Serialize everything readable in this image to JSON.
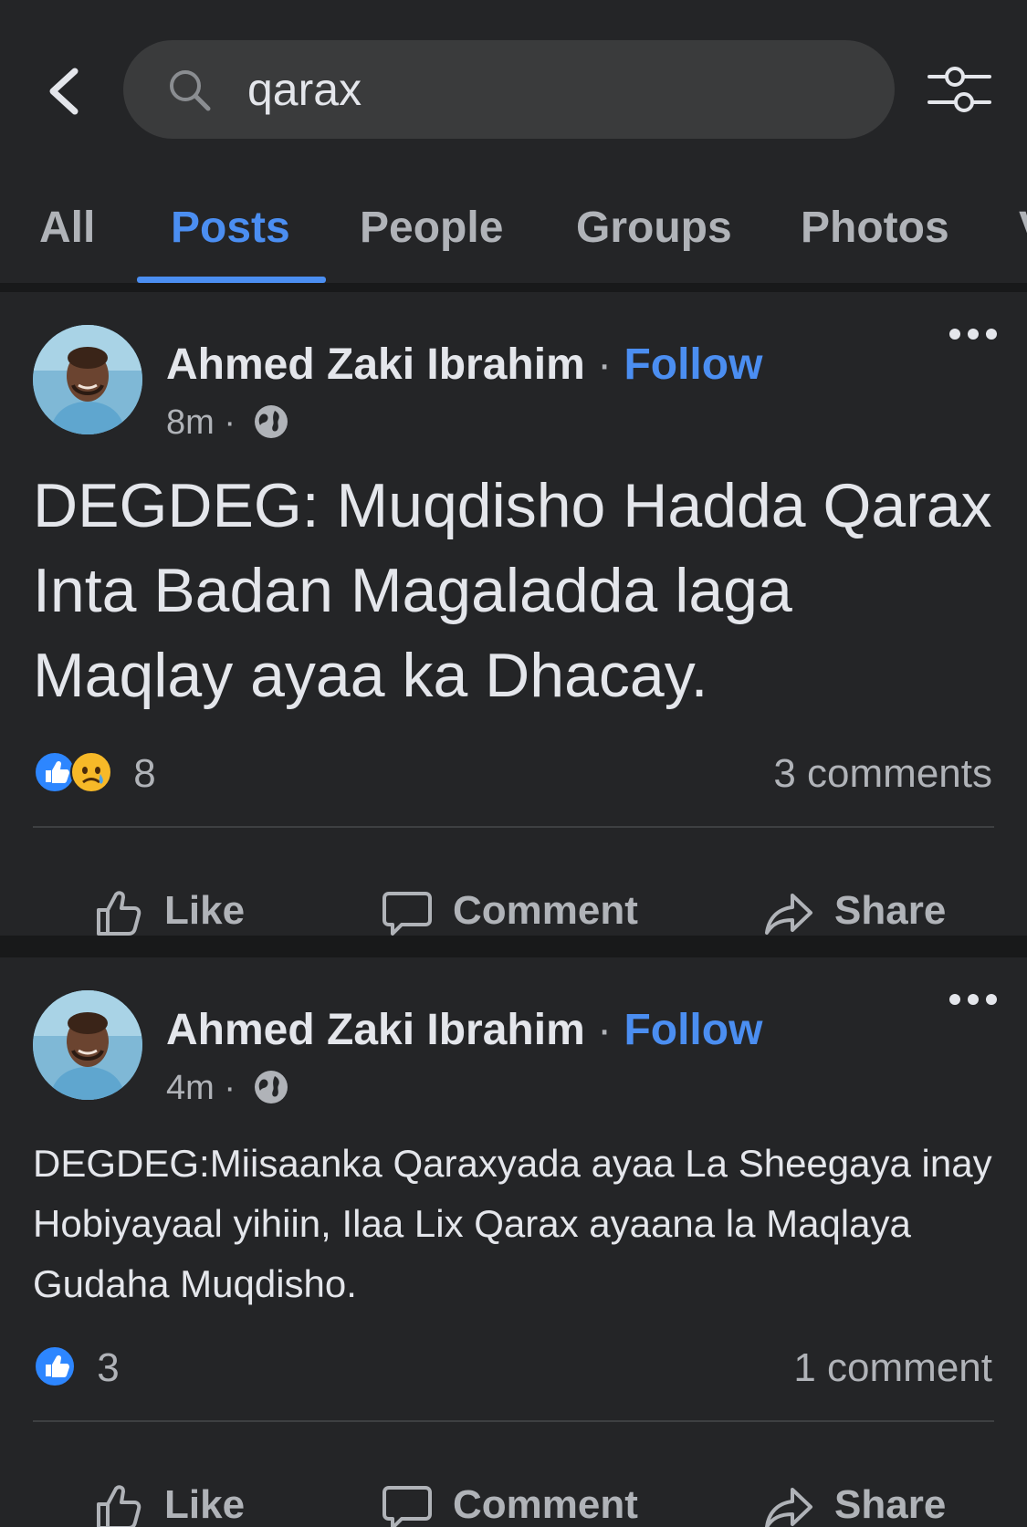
{
  "search": {
    "query": "qarax"
  },
  "tabs": [
    {
      "label": "All",
      "active": false
    },
    {
      "label": "Posts",
      "active": true
    },
    {
      "label": "People",
      "active": false
    },
    {
      "label": "Groups",
      "active": false
    },
    {
      "label": "Photos",
      "active": false
    },
    {
      "label": "V",
      "active": false
    }
  ],
  "colors": {
    "accent": "#4b8ef1",
    "background": "#242527",
    "separator": "#18191a",
    "text": "#e4e6eb",
    "muted": "#b0b3b8"
  },
  "posts": [
    {
      "author": "Ahmed Zaki Ibrahim",
      "separator": "·",
      "follow_label": "Follow",
      "time": "8m",
      "meta_separator": "·",
      "audience_icon": "globe-icon",
      "text": "DEGDEG: Muqdisho Hadda Qarax Inta Badan Magaladda laga Maqlay ayaa ka Dhacay.",
      "reactions": [
        "like",
        "sad"
      ],
      "reaction_count": "8",
      "comments": "3 comments",
      "actions": {
        "like": "Like",
        "comment": "Comment",
        "share": "Share"
      }
    },
    {
      "author": "Ahmed Zaki Ibrahim",
      "separator": "·",
      "follow_label": "Follow",
      "time": "4m",
      "meta_separator": "·",
      "audience_icon": "globe-icon",
      "text": "DEGDEG:Miisaanka Qaraxyada ayaa La Sheegaya inay Hobiyayaal yihiin, Ilaa Lix Qarax ayaana la Maqlaya Gudaha Muqdisho.",
      "reactions": [
        "like"
      ],
      "reaction_count": "3",
      "comments": "1 comment",
      "actions": {
        "like": "Like",
        "comment": "Comment",
        "share": "Share"
      }
    }
  ]
}
